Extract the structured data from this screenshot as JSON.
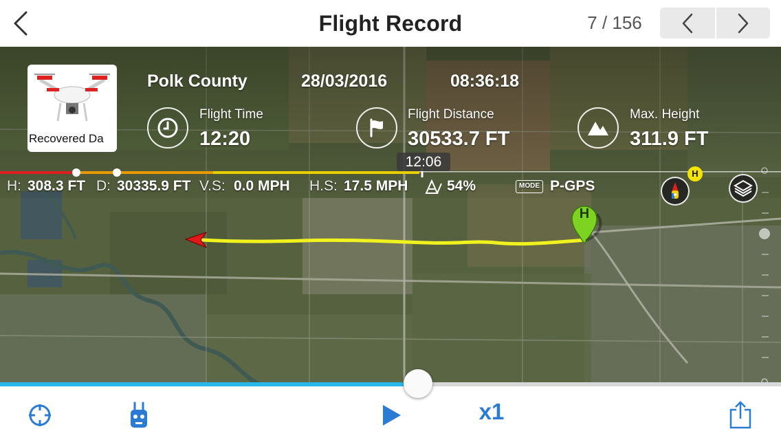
{
  "header": {
    "title": "Flight Record",
    "counter": "7 / 156"
  },
  "record": {
    "thumbnail_label": "Recovered Da",
    "location": "Polk County",
    "date": "28/03/2016",
    "time": "08:36:18"
  },
  "stats": [
    {
      "label": "Flight Time",
      "value": "12:20",
      "icon": "clock-icon"
    },
    {
      "label": "Flight Distance",
      "value": "30533.7 FT",
      "icon": "flag-icon"
    },
    {
      "label": "Max. Height",
      "value": "311.9 FT",
      "icon": "mountain-icon"
    }
  ],
  "timeline": {
    "current_time": "12:06",
    "progress": 0.535,
    "fill_color": "#28b7e8"
  },
  "telemetry": {
    "h_label": "H:",
    "h_value": "308.3 FT",
    "d_label": "D:",
    "d_value": "30335.9 FT",
    "vs_label": "V.S:",
    "vs_value": "0.0 MPH",
    "hs_label": "H.S:",
    "hs_value": "17.5 MPH",
    "battery_value": "54%",
    "mode_tag": "MODE",
    "mode_value": "P-GPS"
  },
  "map": {
    "home_marker": "H",
    "compass_badge": "H",
    "path_color": "#f0f21e"
  },
  "controls": {
    "speed": "x1"
  }
}
